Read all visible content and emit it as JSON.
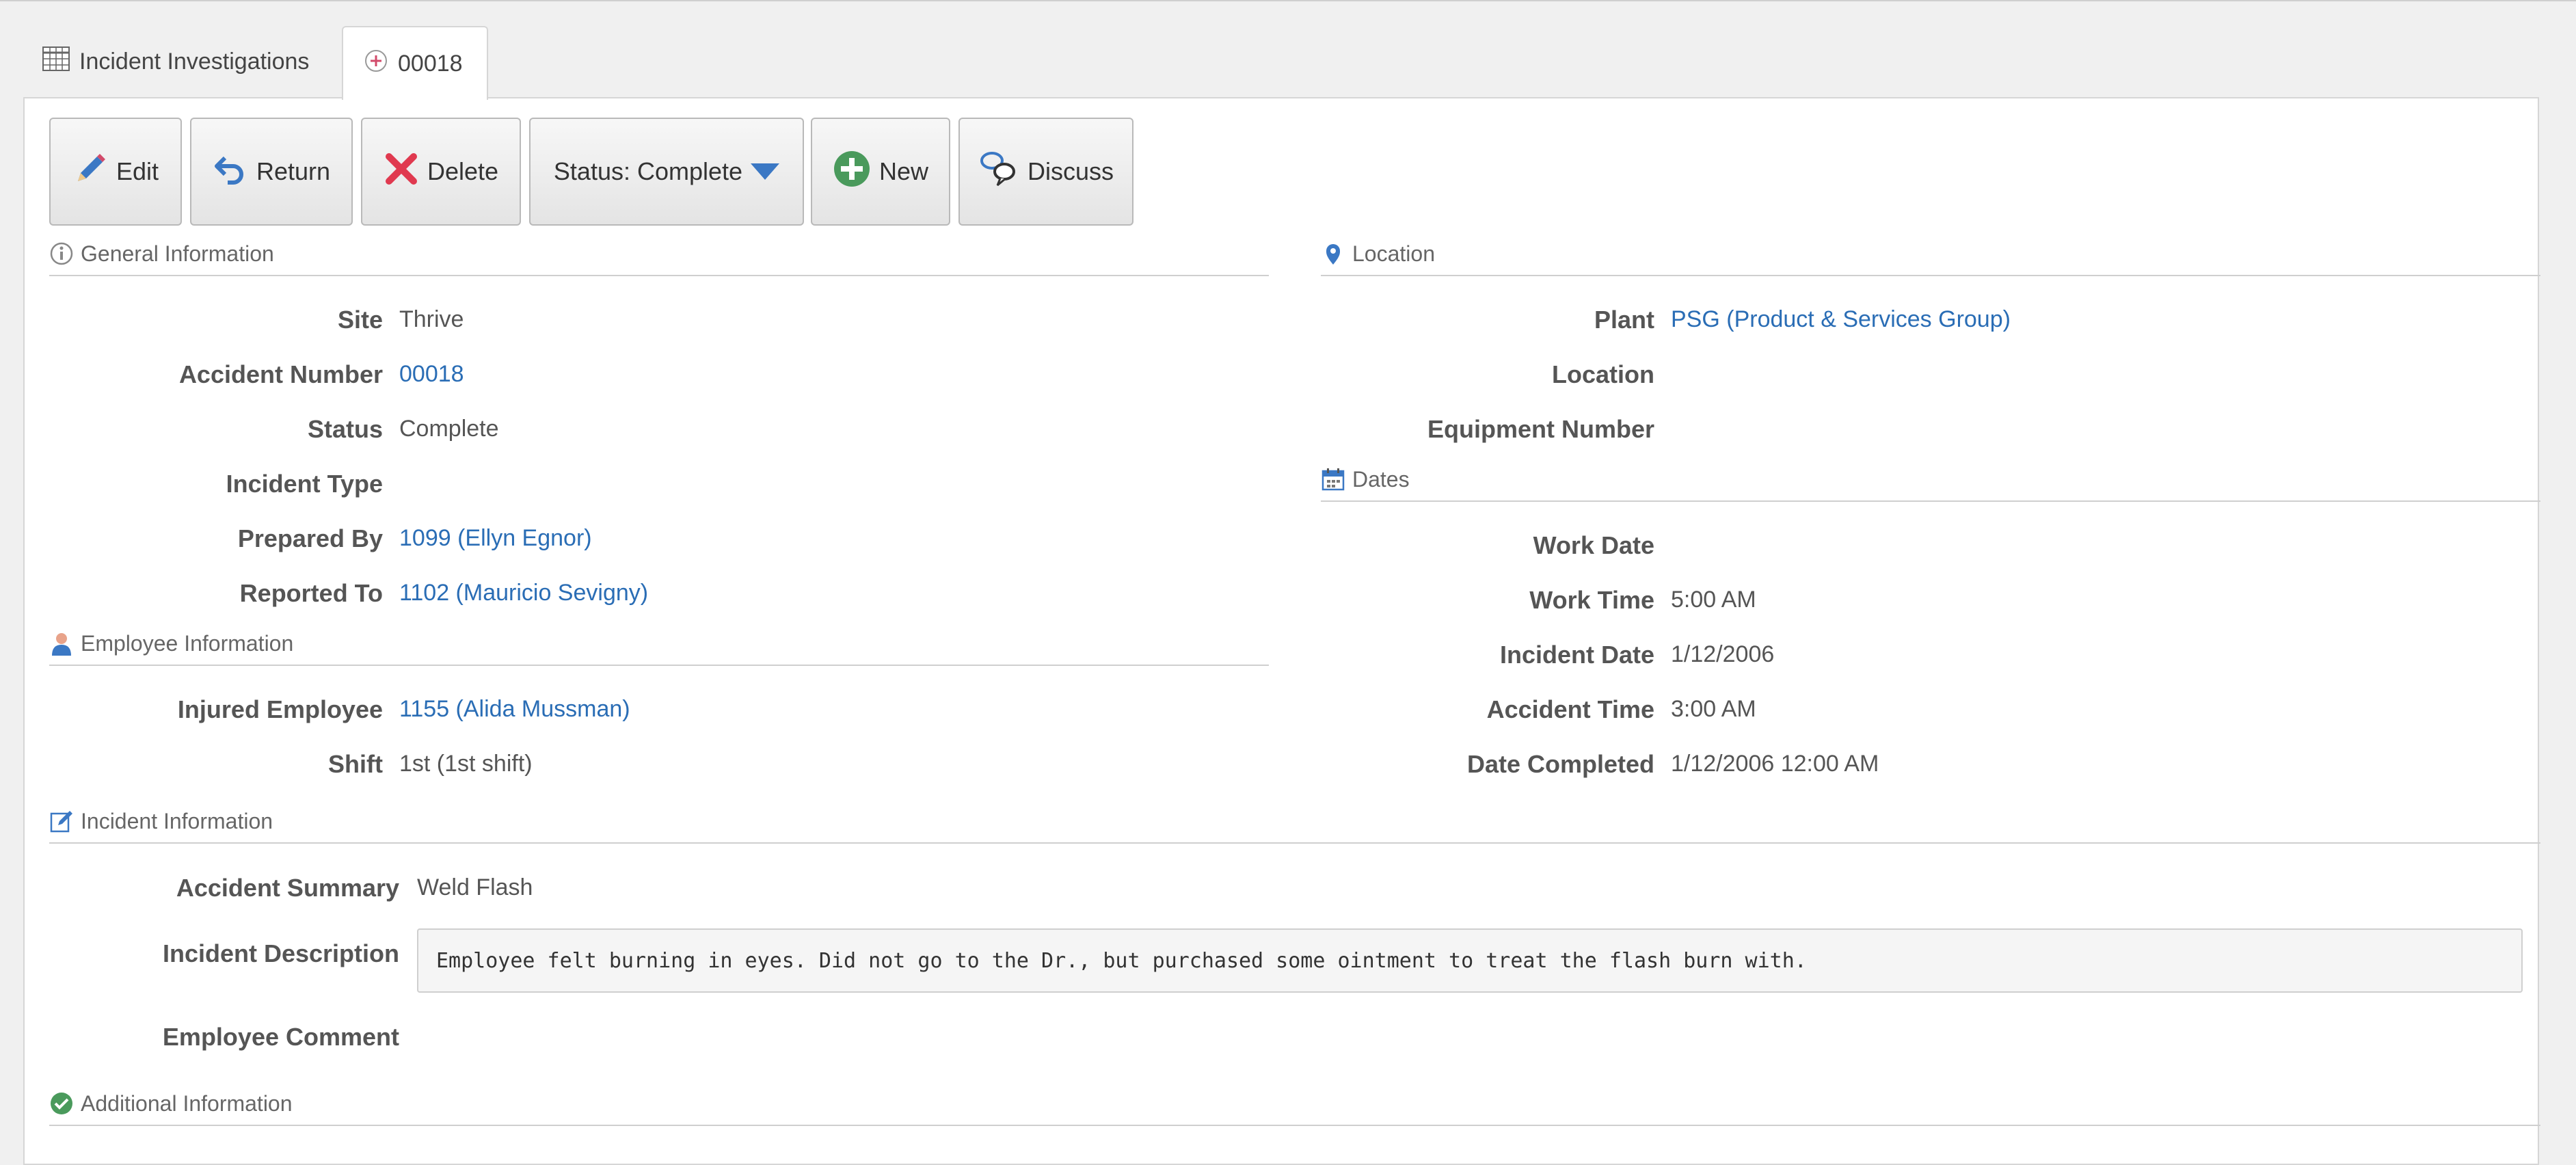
{
  "tabs": {
    "list_label": "Incident Investigations",
    "record_label": "00018"
  },
  "toolbar": {
    "edit": "Edit",
    "return": "Return",
    "delete": "Delete",
    "status": "Status: Complete",
    "new": "New",
    "discuss": "Discuss"
  },
  "general": {
    "header": "General Information",
    "site_label": "Site",
    "site": "Thrive",
    "accident_number_label": "Accident Number",
    "accident_number": "00018",
    "status_label": "Status",
    "status": "Complete",
    "incident_type_label": "Incident Type",
    "incident_type": "",
    "prepared_by_label": "Prepared By",
    "prepared_by": "1099 (Ellyn Egnor)",
    "reported_to_label": "Reported To",
    "reported_to": "1102 (Mauricio Sevigny)"
  },
  "employee": {
    "header": "Employee Information",
    "injured_employee_label": "Injured Employee",
    "injured_employee": "1155 (Alida Mussman)",
    "shift_label": "Shift",
    "shift": "1st (1st shift)"
  },
  "location": {
    "header": "Location",
    "plant_label": "Plant",
    "plant": "PSG (Product & Services Group)",
    "location_label": "Location",
    "location": "",
    "equipment_number_label": "Equipment Number",
    "equipment_number": ""
  },
  "dates": {
    "header": "Dates",
    "work_date_label": "Work Date",
    "work_date": "",
    "work_time_label": "Work Time",
    "work_time": "5:00 AM",
    "incident_date_label": "Incident Date",
    "incident_date": "1/12/2006",
    "accident_time_label": "Accident Time",
    "accident_time": "3:00 AM",
    "date_completed_label": "Date Completed",
    "date_completed": "1/12/2006 12:00 AM"
  },
  "incident": {
    "header": "Incident Information",
    "summary_label": "Accident Summary",
    "summary": "Weld Flash",
    "description_label": "Incident Description",
    "description": "Employee felt burning in eyes.  Did not go to the Dr., but purchased some ointment to treat the flash burn with.",
    "comment_label": "Employee Comment",
    "comment": ""
  },
  "additional": {
    "header": "Additional Information"
  },
  "colors": {
    "link": "#2a6db5",
    "delete_red": "#e0394f",
    "new_green": "#4a9a5c",
    "icon_blue": "#3b78c4"
  }
}
